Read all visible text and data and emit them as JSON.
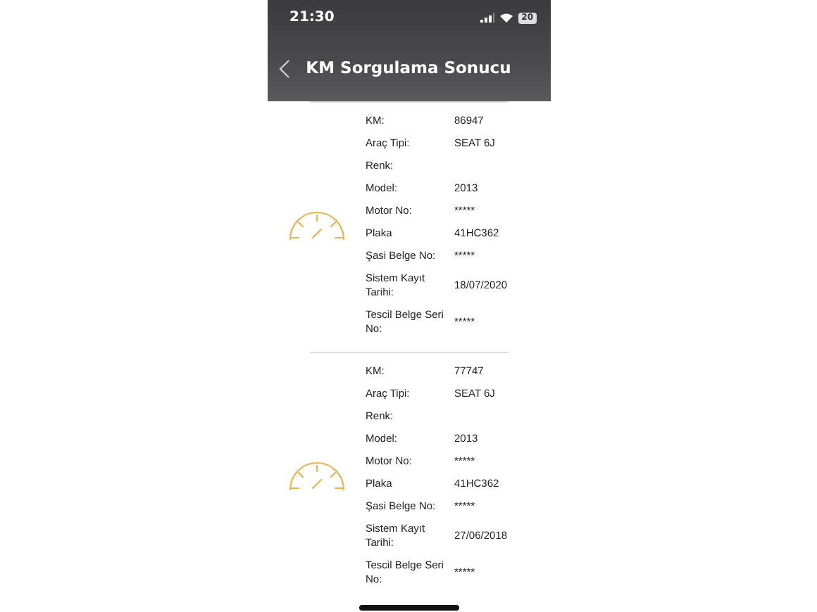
{
  "status_bar": {
    "time": "21:30",
    "battery": "20"
  },
  "header": {
    "title": "KM Sorgulama Sonucu"
  },
  "records": [
    {
      "fields": [
        {
          "label": "KM:",
          "value": "86947"
        },
        {
          "label": "Araç Tipi:",
          "value": "SEAT 6J"
        },
        {
          "label": "Renk:"
        },
        {
          "label": "Model:",
          "value": "2013"
        },
        {
          "label": "Motor No:",
          "value": "*****"
        },
        {
          "label": "Plaka",
          "value": "41HC362"
        },
        {
          "label": "Şasi Belge No:",
          "value": "*****"
        },
        {
          "label": "Sistem Kayıt Tarihi:",
          "value": "18/07/2020"
        },
        {
          "label": "Tescil Belge Seri No:",
          "value": "*****"
        }
      ]
    },
    {
      "fields": [
        {
          "label": "KM:",
          "value": "77747"
        },
        {
          "label": "Araç Tipi:",
          "value": "SEAT 6J"
        },
        {
          "label": "Renk:"
        },
        {
          "label": "Model:",
          "value": "2013"
        },
        {
          "label": "Motor No:",
          "value": "*****"
        },
        {
          "label": "Plaka",
          "value": "41HC362"
        },
        {
          "label": "Şasi Belge No:",
          "value": "*****"
        },
        {
          "label": "Sistem Kayıt Tarihi:",
          "value": "27/06/2018"
        },
        {
          "label": "Tescil Belge Seri No:",
          "value": "*****"
        }
      ]
    }
  ]
}
